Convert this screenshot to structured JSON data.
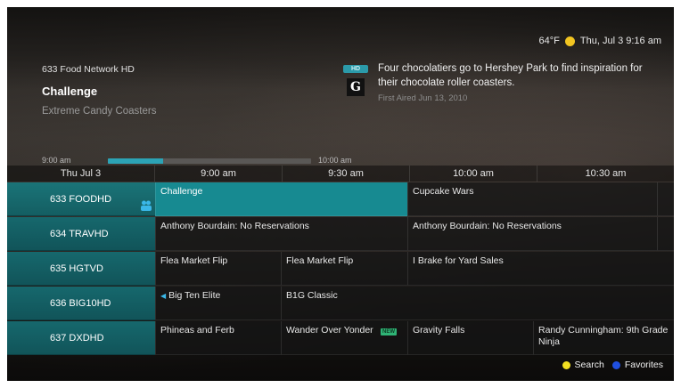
{
  "status": {
    "temperature": "64°F",
    "datetime": "Thu, Jul 3 9:16 am",
    "weather_icon": "sun-icon",
    "sun_color": "#f2c521"
  },
  "info": {
    "channel": "633 Food Network HD",
    "title": "Challenge",
    "episode": "Extreme Candy Coasters",
    "hd_badge": "HD",
    "rating_icon": "rating-icon",
    "rating_symbol": "G",
    "description": "Four chocolatiers go to Hershey Park to find inspiration for their chocolate roller coasters.",
    "first_aired": "First Aired Jun 13, 2010",
    "progress": {
      "start": "9:00 am",
      "end": "10:00 am",
      "fraction": 0.27
    }
  },
  "time_header": {
    "date": "Thu Jul 3",
    "slots": [
      "9:00 am",
      "9:30 am",
      "10:00 am",
      "10:30 am"
    ]
  },
  "rows": [
    {
      "channel": "633 FOODHD",
      "programs": [
        {
          "title": "Challenge",
          "focused": true
        },
        {
          "title": "Cupcake Wars",
          "focused": false
        }
      ]
    },
    {
      "channel": "634 TRAVHD",
      "programs": [
        {
          "title": "Anthony Bourdain: No Reservations",
          "focused": false
        },
        {
          "title": "Anthony Bourdain: No Reservations",
          "focused": false
        }
      ]
    },
    {
      "channel": "635 HGTVD",
      "programs": [
        {
          "title": "Flea Market Flip",
          "focused": false
        },
        {
          "title": "Flea Market Flip",
          "focused": false
        },
        {
          "title": "I Brake for Yard Sales",
          "focused": false
        }
      ]
    },
    {
      "channel": "636 BIG10HD",
      "programs": [
        {
          "title": "Big Ten Elite",
          "focused": false
        },
        {
          "title": "B1G Classic",
          "focused": false
        }
      ]
    },
    {
      "channel": "637 DXDHD",
      "programs": [
        {
          "title": "Phineas and Ferb",
          "focused": false
        },
        {
          "title": "Wander Over Yonder",
          "focused": false
        },
        {
          "title": "Gravity Falls",
          "focused": false
        },
        {
          "title": "Randy Cunningham: 9th Grade Ninja",
          "focused": false
        }
      ]
    }
  ],
  "new_badge": "NEW",
  "footer": {
    "search_label": "Search",
    "favorites_label": "Favorites",
    "search_color": "#f3e021",
    "favorites_color": "#1f4fe0"
  },
  "colors": {
    "accent": "#178a91",
    "channel_column": "#16686d",
    "progress": "#2ca3b5"
  }
}
